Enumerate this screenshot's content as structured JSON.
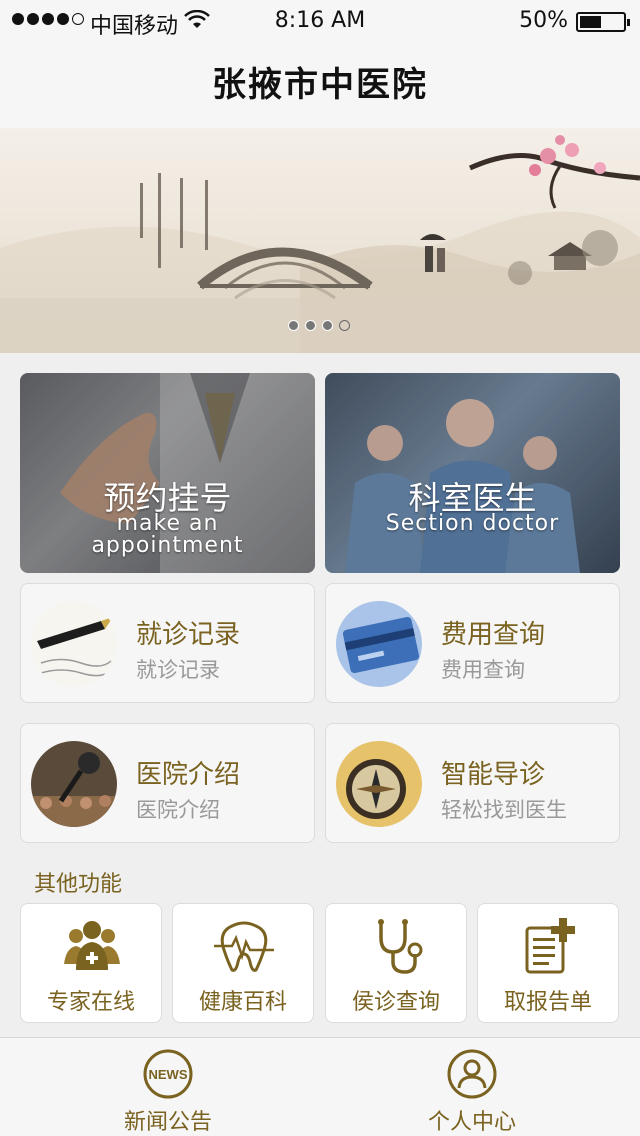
{
  "status_bar": {
    "carrier": "中国移动",
    "time": "8:16 AM",
    "battery_percent": "50%",
    "battery_level": 0.5,
    "signal_bars": 4
  },
  "header": {
    "title": "张掖市中医院"
  },
  "banner": {
    "slide_count": 4,
    "active_slide": 4
  },
  "primary_tiles": [
    {
      "title": "预约挂号",
      "subtitle_line1": "make an",
      "subtitle_line2": "appointment",
      "icon": "handshake-photo"
    },
    {
      "title": "科室医生",
      "subtitle_line1": "Section doctor",
      "subtitle_line2": "",
      "icon": "surgeons-photo"
    }
  ],
  "cards": [
    {
      "title": "就诊记录",
      "subtitle": "就诊记录",
      "icon": "fountain-pen-icon"
    },
    {
      "title": "费用查询",
      "subtitle": "费用查询",
      "icon": "credit-card-icon"
    },
    {
      "title": "医院介绍",
      "subtitle": "医院介绍",
      "icon": "microphone-icon"
    },
    {
      "title": "智能导诊",
      "subtitle": "轻松找到医生",
      "icon": "compass-icon"
    }
  ],
  "other_section": {
    "label": "其他功能"
  },
  "other_tiles": [
    {
      "label": "专家在线",
      "icon": "experts-group-icon"
    },
    {
      "label": "健康百科",
      "icon": "heartbeat-tooth-icon"
    },
    {
      "label": "侯诊查询",
      "icon": "stethoscope-icon"
    },
    {
      "label": "取报告单",
      "icon": "report-plus-icon"
    }
  ],
  "tab_bar": [
    {
      "label": "新闻公告",
      "icon": "news-icon"
    },
    {
      "label": "个人中心",
      "icon": "person-icon"
    }
  ],
  "colors": {
    "accent": "#7a6220",
    "background": "#efefef",
    "card": "#f6f6f6"
  }
}
